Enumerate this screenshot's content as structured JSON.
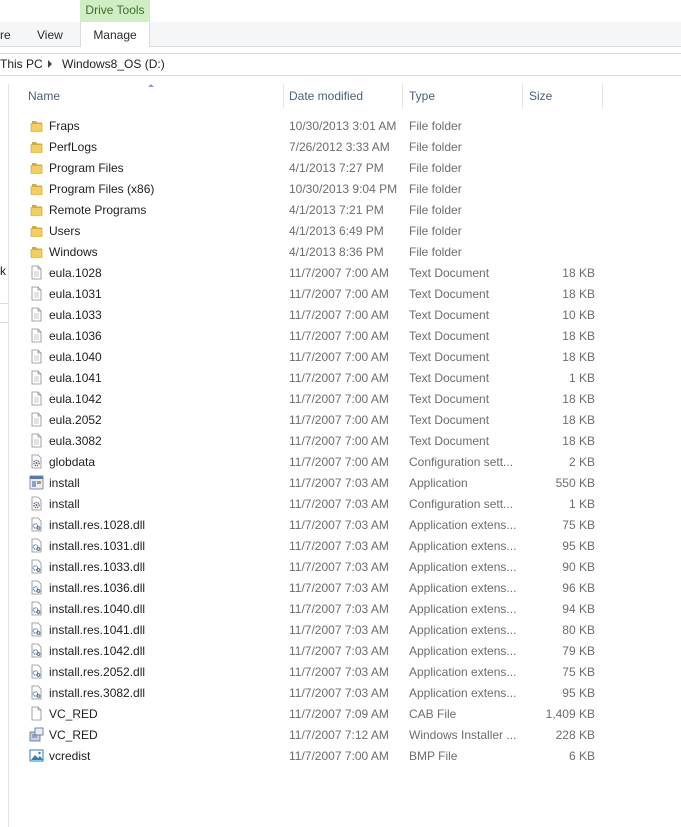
{
  "ribbon": {
    "context_tab": "Drive Tools",
    "tabs": [
      "re",
      "View",
      "Manage"
    ]
  },
  "address": {
    "crumbs": [
      "This PC",
      "Windows8_OS (D:)"
    ]
  },
  "nav": {
    "fragment": "k"
  },
  "columns": {
    "name": "Name",
    "date": "Date modified",
    "type": "Type",
    "size": "Size"
  },
  "files": [
    {
      "name": "Fraps",
      "date": "10/30/2013 3:01 AM",
      "type": "File folder",
      "size": "",
      "icon": "folder-icon"
    },
    {
      "name": "PerfLogs",
      "date": "7/26/2012 3:33 AM",
      "type": "File folder",
      "size": "",
      "icon": "folder-icon"
    },
    {
      "name": "Program Files",
      "date": "4/1/2013 7:27 PM",
      "type": "File folder",
      "size": "",
      "icon": "folder-icon"
    },
    {
      "name": "Program Files (x86)",
      "date": "10/30/2013 9:04 PM",
      "type": "File folder",
      "size": "",
      "icon": "folder-icon"
    },
    {
      "name": "Remote Programs",
      "date": "4/1/2013 7:21 PM",
      "type": "File folder",
      "size": "",
      "icon": "folder-icon"
    },
    {
      "name": "Users",
      "date": "4/1/2013 6:49 PM",
      "type": "File folder",
      "size": "",
      "icon": "folder-icon"
    },
    {
      "name": "Windows",
      "date": "4/1/2013 8:36 PM",
      "type": "File folder",
      "size": "",
      "icon": "folder-icon"
    },
    {
      "name": "eula.1028",
      "date": "11/7/2007 7:00 AM",
      "type": "Text Document",
      "size": "18 KB",
      "icon": "text-document-icon"
    },
    {
      "name": "eula.1031",
      "date": "11/7/2007 7:00 AM",
      "type": "Text Document",
      "size": "18 KB",
      "icon": "text-document-icon"
    },
    {
      "name": "eula.1033",
      "date": "11/7/2007 7:00 AM",
      "type": "Text Document",
      "size": "10 KB",
      "icon": "text-document-icon"
    },
    {
      "name": "eula.1036",
      "date": "11/7/2007 7:00 AM",
      "type": "Text Document",
      "size": "18 KB",
      "icon": "text-document-icon"
    },
    {
      "name": "eula.1040",
      "date": "11/7/2007 7:00 AM",
      "type": "Text Document",
      "size": "18 KB",
      "icon": "text-document-icon"
    },
    {
      "name": "eula.1041",
      "date": "11/7/2007 7:00 AM",
      "type": "Text Document",
      "size": "1 KB",
      "icon": "text-document-icon"
    },
    {
      "name": "eula.1042",
      "date": "11/7/2007 7:00 AM",
      "type": "Text Document",
      "size": "18 KB",
      "icon": "text-document-icon"
    },
    {
      "name": "eula.2052",
      "date": "11/7/2007 7:00 AM",
      "type": "Text Document",
      "size": "18 KB",
      "icon": "text-document-icon"
    },
    {
      "name": "eula.3082",
      "date": "11/7/2007 7:00 AM",
      "type": "Text Document",
      "size": "18 KB",
      "icon": "text-document-icon"
    },
    {
      "name": "globdata",
      "date": "11/7/2007 7:00 AM",
      "type": "Configuration sett...",
      "size": "2 KB",
      "icon": "config-settings-icon"
    },
    {
      "name": "install",
      "date": "11/7/2007 7:03 AM",
      "type": "Application",
      "size": "550 KB",
      "icon": "application-icon"
    },
    {
      "name": "install",
      "date": "11/7/2007 7:03 AM",
      "type": "Configuration sett...",
      "size": "1 KB",
      "icon": "config-settings-icon"
    },
    {
      "name": "install.res.1028.dll",
      "date": "11/7/2007 7:03 AM",
      "type": "Application extens...",
      "size": "75 KB",
      "icon": "dll-icon"
    },
    {
      "name": "install.res.1031.dll",
      "date": "11/7/2007 7:03 AM",
      "type": "Application extens...",
      "size": "95 KB",
      "icon": "dll-icon"
    },
    {
      "name": "install.res.1033.dll",
      "date": "11/7/2007 7:03 AM",
      "type": "Application extens...",
      "size": "90 KB",
      "icon": "dll-icon"
    },
    {
      "name": "install.res.1036.dll",
      "date": "11/7/2007 7:03 AM",
      "type": "Application extens...",
      "size": "96 KB",
      "icon": "dll-icon"
    },
    {
      "name": "install.res.1040.dll",
      "date": "11/7/2007 7:03 AM",
      "type": "Application extens...",
      "size": "94 KB",
      "icon": "dll-icon"
    },
    {
      "name": "install.res.1041.dll",
      "date": "11/7/2007 7:03 AM",
      "type": "Application extens...",
      "size": "80 KB",
      "icon": "dll-icon"
    },
    {
      "name": "install.res.1042.dll",
      "date": "11/7/2007 7:03 AM",
      "type": "Application extens...",
      "size": "79 KB",
      "icon": "dll-icon"
    },
    {
      "name": "install.res.2052.dll",
      "date": "11/7/2007 7:03 AM",
      "type": "Application extens...",
      "size": "75 KB",
      "icon": "dll-icon"
    },
    {
      "name": "install.res.3082.dll",
      "date": "11/7/2007 7:03 AM",
      "type": "Application extens...",
      "size": "95 KB",
      "icon": "dll-icon"
    },
    {
      "name": "VC_RED",
      "date": "11/7/2007 7:09 AM",
      "type": "CAB File",
      "size": "1,409 KB",
      "icon": "cab-file-icon"
    },
    {
      "name": "VC_RED",
      "date": "11/7/2007 7:12 AM",
      "type": "Windows Installer ...",
      "size": "228 KB",
      "icon": "installer-package-icon"
    },
    {
      "name": "vcredist",
      "date": "11/7/2007 7:00 AM",
      "type": "BMP File",
      "size": "6 KB",
      "icon": "bitmap-image-icon"
    }
  ],
  "colors": {
    "header_text": "#4c607a",
    "drive_tools_bg": "#cfeec3",
    "folder": "#e8c04c"
  }
}
